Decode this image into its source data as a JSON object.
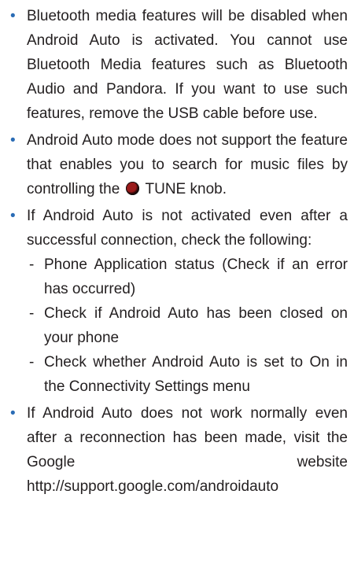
{
  "items": [
    {
      "text": "Bluetooth media features will be disabled when Android Auto is activated. You cannot use Bluetooth Media features such as Bluetooth Audio and Pandora. If you want to use such features, remove the USB cable before use."
    },
    {
      "text_before": "Android Auto mode does not support the feature that enables you to search for music files by controlling the",
      "knob_icon": "tune-knob-icon",
      "text_after": " TUNE knob."
    },
    {
      "text": "If Android Auto is not activated even after a successful connection, check the following:",
      "subitems": [
        "Phone Application status (Check if an error has occurred)",
        "Check if Android Auto has been closed on your phone",
        "Check whether Android Auto is set to On in the Connectivity Settings menu"
      ]
    },
    {
      "text": "If Android Auto does not work normally even after a reconnection has been made, visit the Google website http://support.google.com/androidauto"
    }
  ],
  "colors": {
    "bullet": "#2a6cb5",
    "text": "#231f20",
    "knob": "#8b1a1a"
  }
}
